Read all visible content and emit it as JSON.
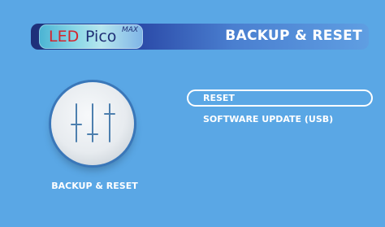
{
  "header": {
    "logo": {
      "led": "LED",
      "pico": "Pico",
      "max": "MAX"
    },
    "title": "BACKUP & RESET"
  },
  "section": {
    "icon": "equalizer-sliders-icon",
    "caption": "BACKUP & RESET"
  },
  "menu": {
    "items": [
      {
        "label": "RESET",
        "selected": true
      },
      {
        "label": "SOFTWARE UPDATE (USB)",
        "selected": false
      }
    ]
  },
  "colors": {
    "background": "#5aa7e5",
    "header_dark": "#1e2f78",
    "logo_red": "#d4252d",
    "text": "#ffffff"
  }
}
